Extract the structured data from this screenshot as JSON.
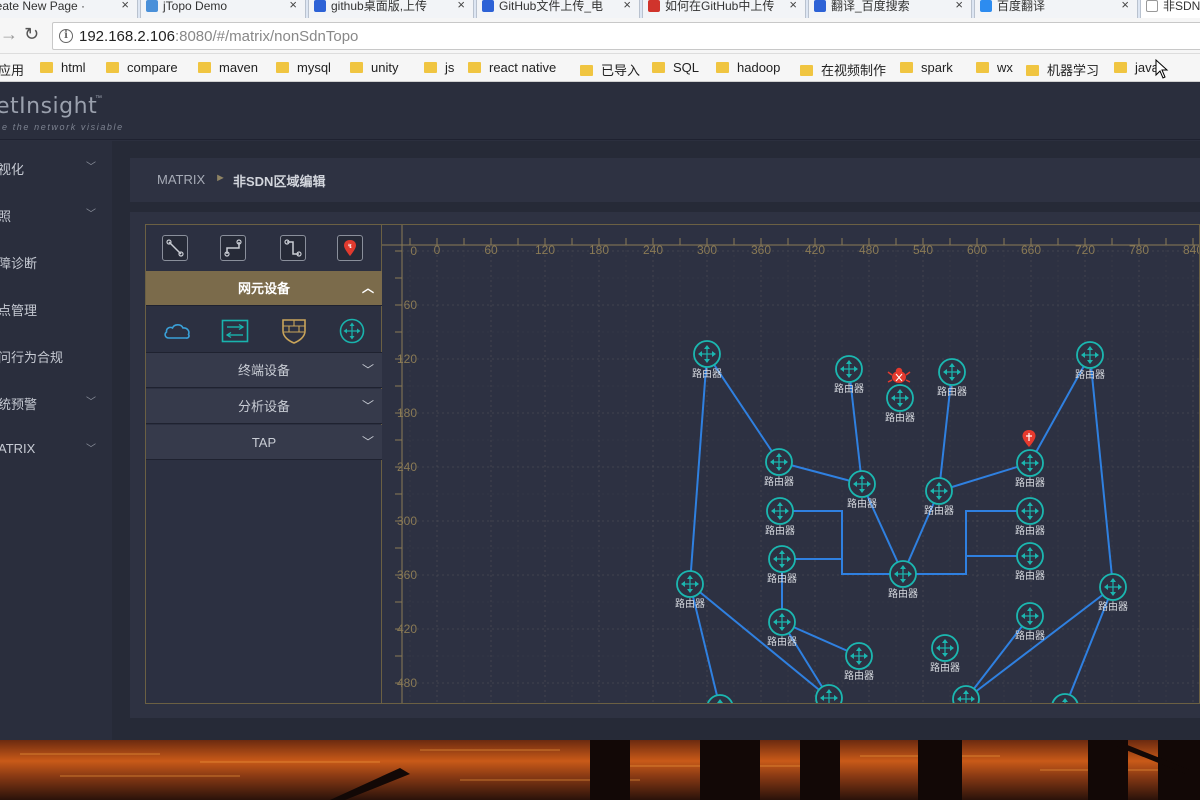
{
  "browser": {
    "tabs": [
      {
        "title": "Create New Page ·",
        "icon_color": "#9a9a9a"
      },
      {
        "title": "jTopo Demo",
        "icon_color": "#4a90d9"
      },
      {
        "title": "github桌面版,上传",
        "icon_color": "#2d62d6"
      },
      {
        "title": "GitHub文件上传_电",
        "icon_color": "#2d62d6"
      },
      {
        "title": "如何在GitHub中上传",
        "icon_color": "#d0342c"
      },
      {
        "title": "翻译_百度搜索",
        "icon_color": "#2d62d6"
      },
      {
        "title": "百度翻译",
        "icon_color": "#2d8cf0"
      },
      {
        "title": "非SDN",
        "icon_color": "#ffffff"
      }
    ],
    "url_host": "192.168.2.106",
    "url_rest": ":8080/#/matrix/nonSdnTopo",
    "bookmarks": [
      "应用",
      "html",
      "compare",
      "maven",
      "mysql",
      "unity",
      "js",
      "react native",
      "已导入",
      "SQL",
      "hadoop",
      "在视频制作",
      "spark",
      "wx",
      "机器学习",
      "java"
    ]
  },
  "app": {
    "logo": "etInsight",
    "logo_tm": "™",
    "logo_sub": "e the network visiable",
    "sidebar": [
      {
        "label": "视化",
        "has_chevron": true
      },
      {
        "label": "照",
        "has_chevron": true
      },
      {
        "label": "障诊断",
        "has_chevron": false
      },
      {
        "label": "点管理",
        "has_chevron": false
      },
      {
        "label": "问行为合规",
        "has_chevron": false
      },
      {
        "label": "统预警",
        "has_chevron": true
      },
      {
        "label": "ATRIX",
        "has_chevron": true
      }
    ],
    "breadcrumb": {
      "root": "MATRIX",
      "separator": "►",
      "current": "非SDN区域编辑"
    }
  },
  "palette": {
    "tools": [
      "straight-link-icon",
      "elbow-link-icon",
      "step-link-icon",
      "alarm-marker-icon"
    ],
    "sections": [
      {
        "label": "网元设备",
        "open": true
      },
      {
        "label": "终端设备",
        "open": false
      },
      {
        "label": "分析设备",
        "open": false
      },
      {
        "label": "TAP",
        "open": false
      }
    ],
    "devices": [
      "cloud-icon",
      "switch-icon",
      "firewall-icon",
      "router-icon"
    ]
  },
  "topology": {
    "x_ticks": [
      "0",
      "60",
      "120",
      "180",
      "240",
      "300",
      "360",
      "420",
      "480",
      "540",
      "600",
      "660",
      "720",
      "780",
      "840"
    ],
    "y_ticks": [
      "0",
      "60",
      "120",
      "180",
      "240",
      "300",
      "360",
      "420",
      "480"
    ],
    "node_label": "路由器",
    "colors": {
      "link": "#2f80e0",
      "node": "#1bb7b0",
      "alert": "#e63a2e",
      "ruler": "#8a7a55"
    }
  }
}
